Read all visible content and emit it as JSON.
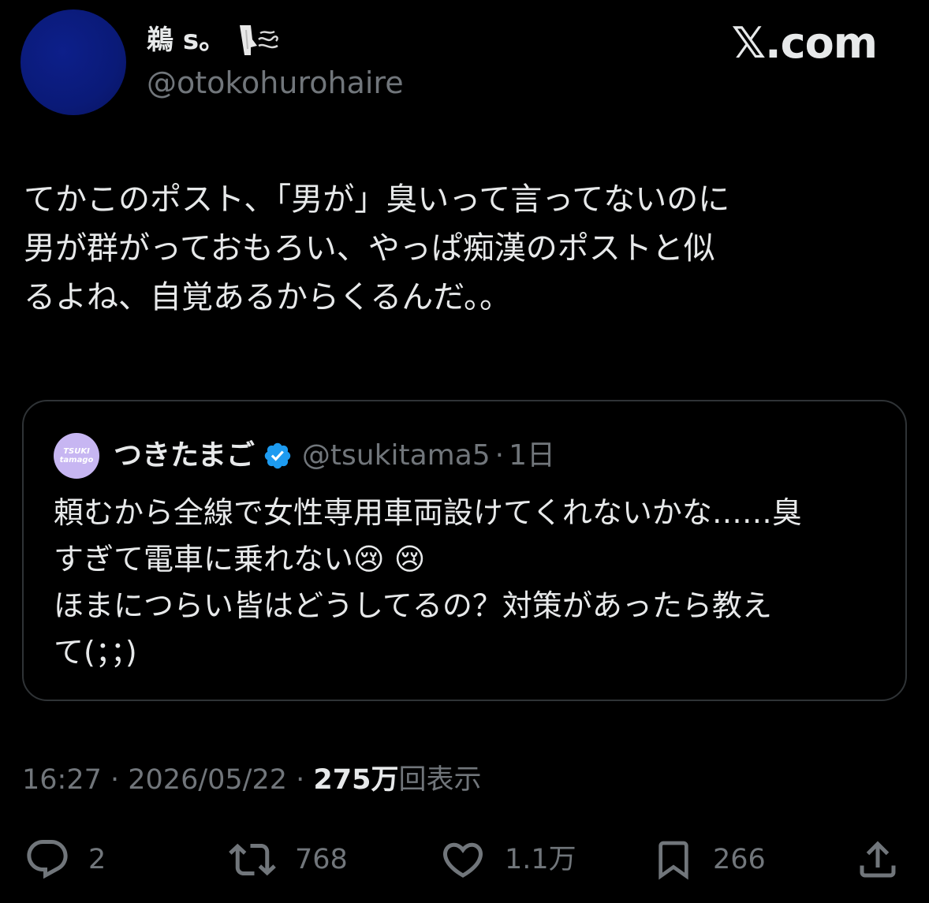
{
  "author": {
    "display_name": "鵜 s。",
    "handle": "@otokohurohaire",
    "avatar_color": "#0b1a7a"
  },
  "brand": "𝕏.com",
  "post": {
    "text": "てかこのポスト、「男が」臭いって言ってないのに\n男が群がっておもろい、やっぱ痴漢のポストと似\nるよね、自覚あるからくるんだ。。"
  },
  "quote": {
    "avatar_text_1": "TSUKI",
    "avatar_text_2": "tamago",
    "display_name": "つきたまご",
    "handle": "@tsukitama5",
    "separator": "·",
    "time": "1日",
    "text": "頼むから全線で女性専用車両設けてくれないかな……臭\nすぎて電車に乗れない😢 😢\nほまにつらい皆はどうしてるの？対策があったら教え\nて(；；)"
  },
  "meta": {
    "time": "16:27",
    "sep1": " · ",
    "date": "2026/05/22",
    "sep2": " · ",
    "views_count": "275万",
    "views_label": "回表示"
  },
  "actions": {
    "reply_count": "2",
    "repost_count": "768",
    "like_count": "1.1万",
    "bookmark_count": "266"
  },
  "colors": {
    "background": "#000000",
    "text": "#e7e9ea",
    "muted": "#71767b",
    "border": "#2f3336",
    "verified": "#1d9bf0"
  },
  "icons": [
    "smelling-emoji-icon",
    "verified-badge-icon",
    "reply-icon",
    "repost-icon",
    "like-icon",
    "bookmark-icon",
    "share-icon"
  ]
}
